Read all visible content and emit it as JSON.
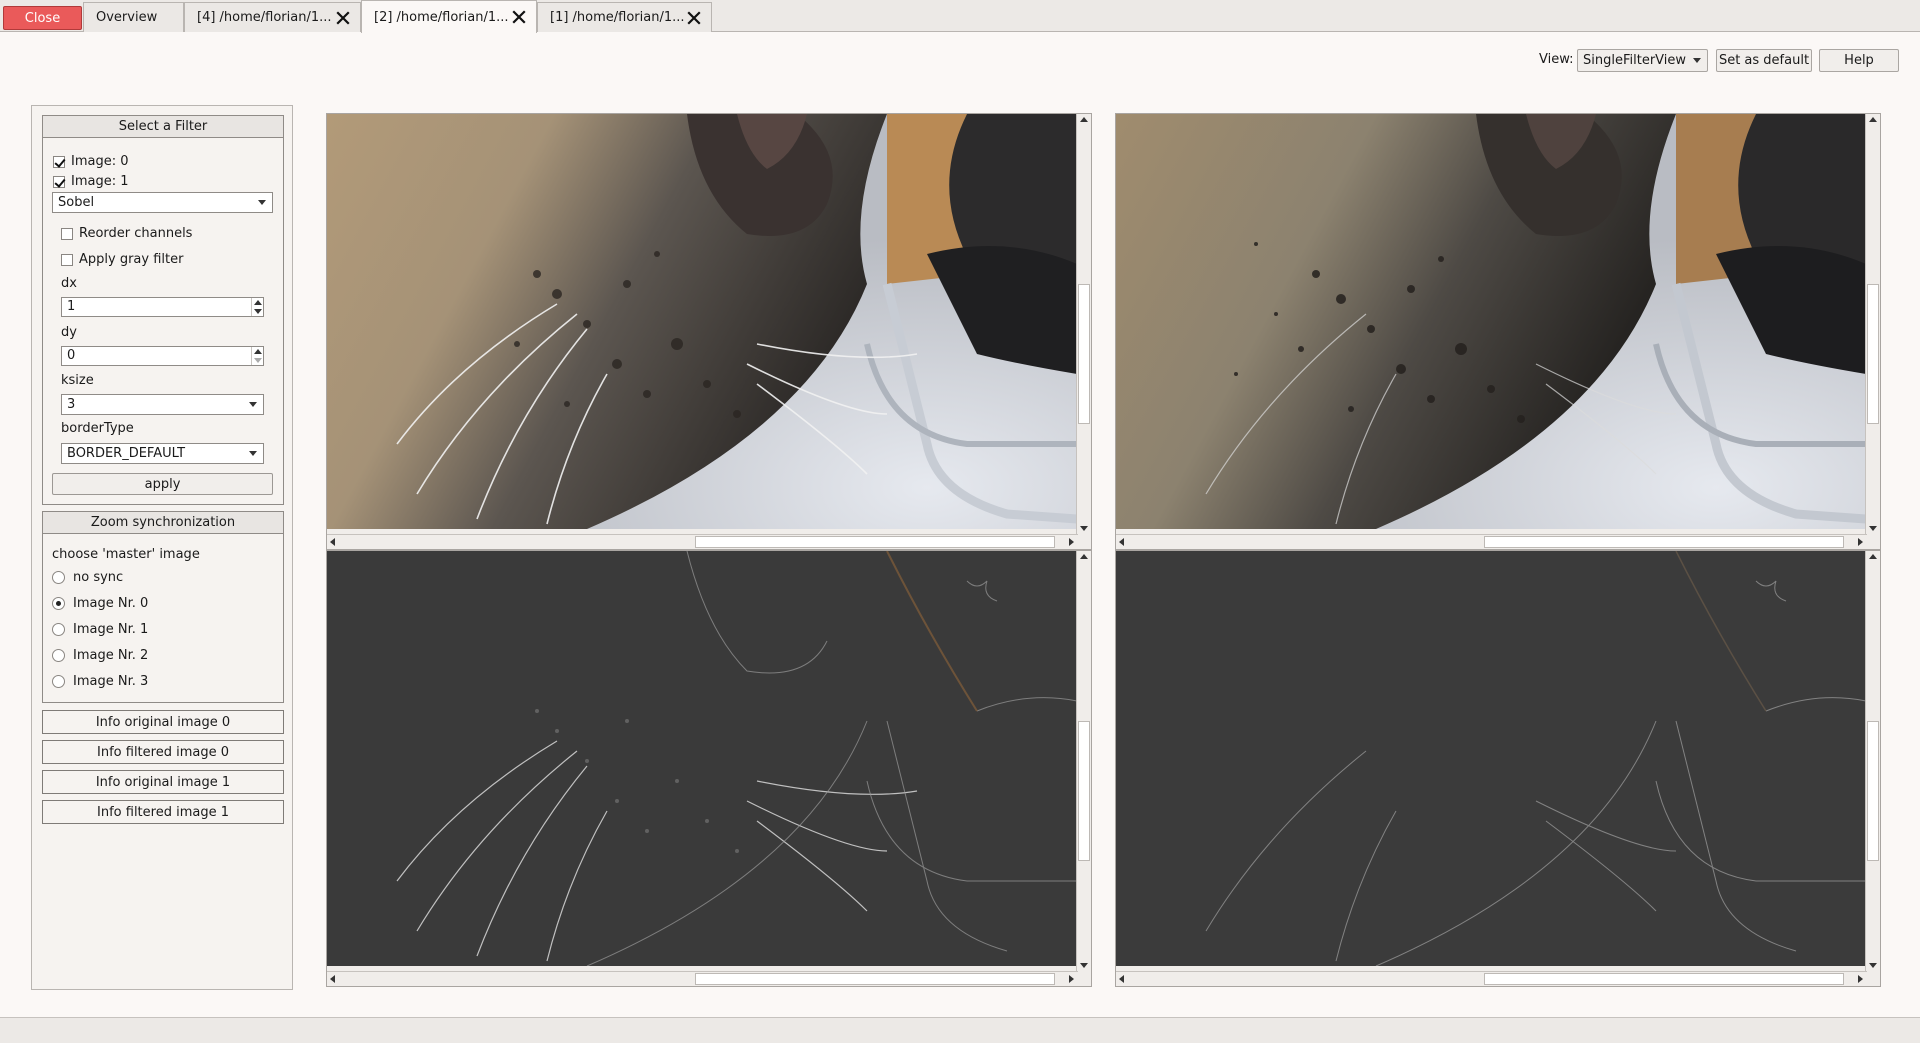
{
  "tabs": {
    "close_label": "Close",
    "items": [
      {
        "label": "Overview"
      },
      {
        "label": "[4] /home/florian/1..."
      },
      {
        "label": "[2] /home/florian/1..."
      },
      {
        "label": "[1] /home/florian/1..."
      }
    ],
    "active_index": 2
  },
  "toolbar": {
    "view_label": "View:",
    "view_value": "SingleFilterView",
    "set_default_label": "Set as default",
    "help_label": "Help"
  },
  "filter_group": {
    "title": "Select a Filter",
    "image0_label": "Image: 0",
    "image0_checked": true,
    "image1_label": "Image: 1",
    "image1_checked": true,
    "filter_value": "Sobel",
    "reorder_label": "Reorder channels",
    "reorder_checked": false,
    "gray_label": "Apply gray filter",
    "gray_checked": false,
    "dx_label": "dx",
    "dx_value": "1",
    "dy_label": "dy",
    "dy_value": "0",
    "ksize_label": "ksize",
    "ksize_value": "3",
    "border_label": "borderType",
    "border_value": "BORDER_DEFAULT",
    "apply_label": "apply"
  },
  "zoom_group": {
    "title": "Zoom synchronization",
    "prompt": "choose 'master' image",
    "options": [
      {
        "label": "no sync",
        "checked": false
      },
      {
        "label": "Image Nr. 0",
        "checked": true
      },
      {
        "label": "Image Nr. 1",
        "checked": false
      },
      {
        "label": "Image Nr. 2",
        "checked": false
      },
      {
        "label": "Image Nr. 3",
        "checked": false
      }
    ]
  },
  "info_buttons": [
    {
      "label": "Info original image 0"
    },
    {
      "label": "Info filtered image 0"
    },
    {
      "label": "Info original image 1"
    },
    {
      "label": "Info filtered image 1"
    }
  ],
  "icons": {
    "tab_close": "close-icon",
    "combo_arrow": "chevron-down-icon"
  },
  "colors": {
    "close_button": "#ea5a5a",
    "filtered_background": "#3a3a3a"
  }
}
